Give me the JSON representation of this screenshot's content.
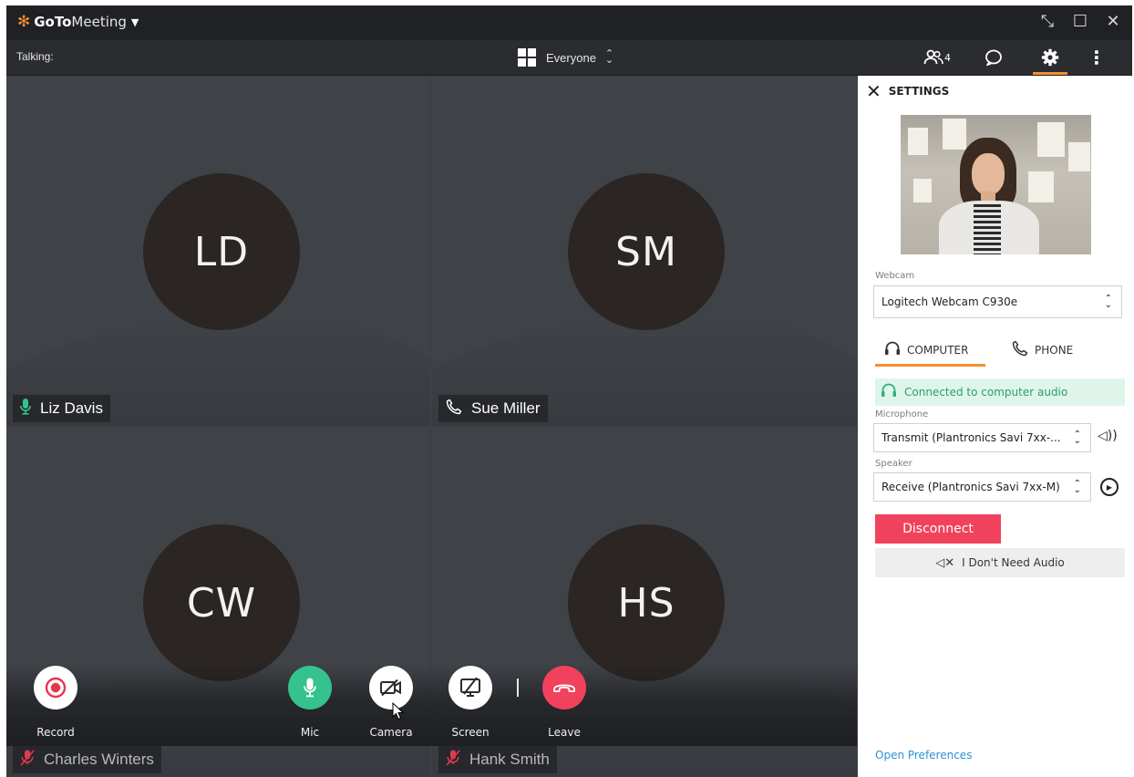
{
  "titlebar": {
    "brand_bold": "GoTo",
    "brand_thin": "Meeting",
    "window_controls": [
      "collapse-icon",
      "maximize-icon",
      "close-icon"
    ]
  },
  "toolbar": {
    "talking_label": "Talking:",
    "layout_label": "Everyone",
    "attendee_count": "4",
    "right_icons": [
      "people-icon",
      "chat-icon",
      "gear-icon",
      "more-vertical-icon"
    ]
  },
  "participants": [
    {
      "initials": "LD",
      "name": "Liz Davis",
      "status_icon": "mic-icon",
      "status_color": "#36c28f"
    },
    {
      "initials": "SM",
      "name": "Sue Miller",
      "status_icon": "phone-icon",
      "status_color": "#ffffff"
    },
    {
      "initials": "CW",
      "name": "Charles Winters",
      "status_icon": "mic-muted-icon",
      "status_color": "#e03a4e"
    },
    {
      "initials": "HS",
      "name": "Hank Smith",
      "status_icon": "mic-muted-icon",
      "status_color": "#e03a4e"
    }
  ],
  "controls": {
    "record": "Record",
    "mic": "Mic",
    "camera": "Camera",
    "screen": "Screen",
    "leave": "Leave"
  },
  "settings": {
    "title": "SETTINGS",
    "webcam_label": "Webcam",
    "webcam_value": "Logitech Webcam C930e",
    "tab_computer": "COMPUTER",
    "tab_phone": "PHONE",
    "connected_text": "Connected to computer audio",
    "microphone_label": "Microphone",
    "microphone_value": "Transmit (Plantronics Savi 7xx-...",
    "speaker_label": "Speaker",
    "speaker_value": "Receive (Plantronics Savi 7xx-M)",
    "disconnect": "Disconnect",
    "no_audio": "I Don't Need Audio",
    "open_preferences": "Open Preferences"
  },
  "colors": {
    "accent": "#f68d2e",
    "mic_green": "#36c28f",
    "leave_red": "#f0425c",
    "record_red": "#e8334a",
    "link_blue": "#2b8fd6"
  }
}
